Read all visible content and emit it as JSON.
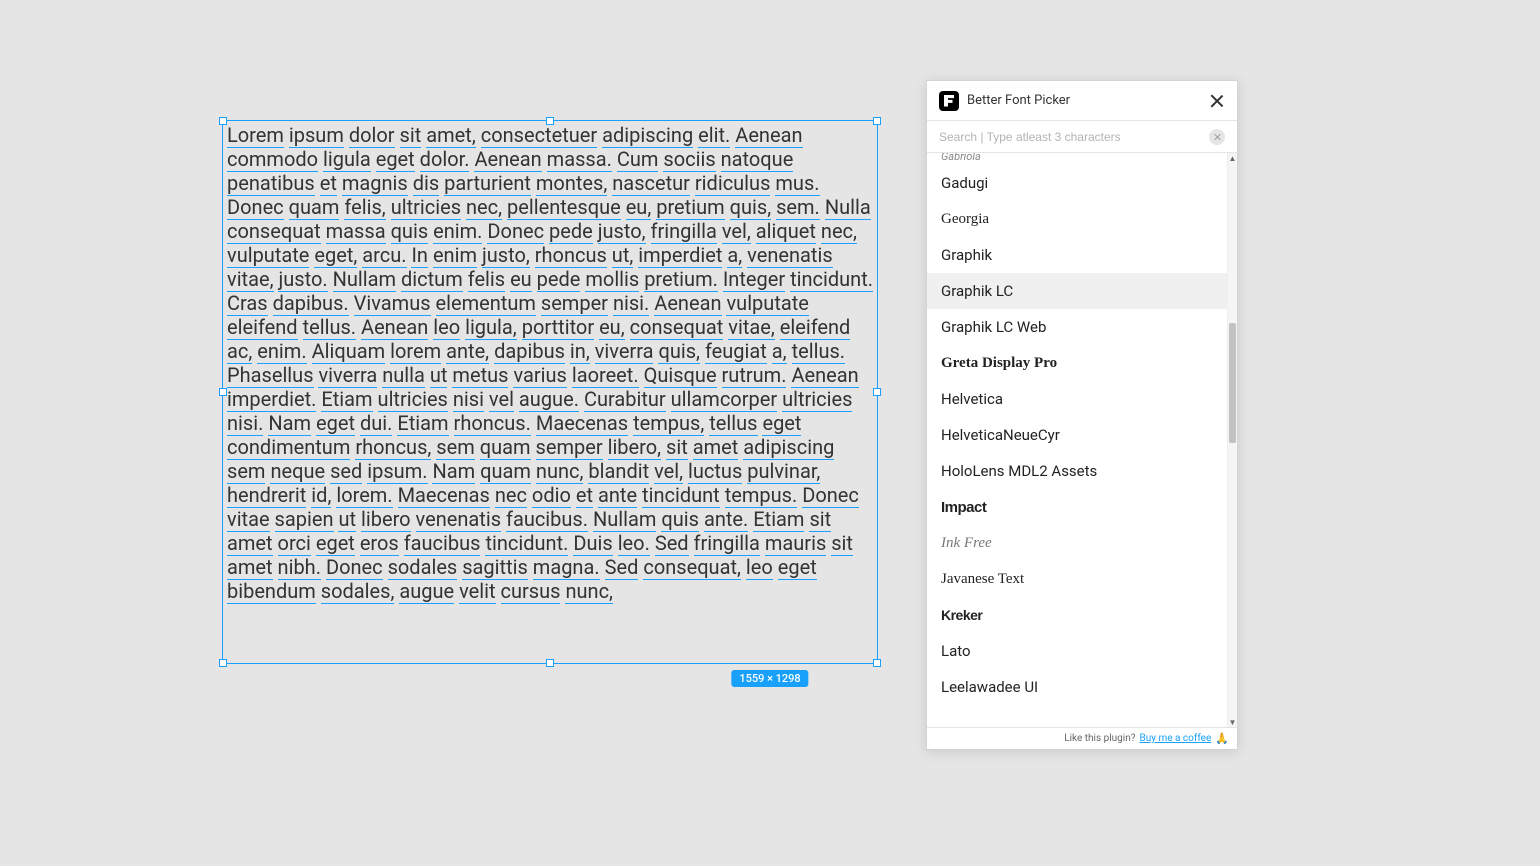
{
  "canvas": {
    "text": "Lorem ipsum dolor sit amet, consectetuer adipiscing elit. Aenean commodo ligula eget dolor. Aenean massa. Cum sociis natoque penatibus et magnis dis parturient montes, nascetur ridiculus mus. Donec quam felis, ultricies nec, pellentesque eu, pretium quis, sem. Nulla consequat massa quis enim. Donec pede justo, fringilla vel, aliquet nec, vulputate eget, arcu. In enim justo, rhoncus ut, imperdiet a, venenatis vitae, justo. Nullam dictum felis eu pede mollis pretium. Integer tincidunt. Cras dapibus. Vivamus elementum semper nisi. Aenean vulputate eleifend tellus. Aenean leo ligula, porttitor eu, consequat vitae, eleifend ac, enim. Aliquam lorem ante, dapibus in, viverra quis, feugiat a, tellus. Phasellus viverra nulla ut metus varius laoreet. Quisque rutrum. Aenean imperdiet. Etiam ultricies nisi vel augue. Curabitur ullamcorper ultricies nisi. Nam eget dui. Etiam rhoncus. Maecenas tempus, tellus eget condimentum rhoncus, sem quam semper libero, sit amet adipiscing sem neque sed ipsum. Nam quam nunc, blandit vel, luctus pulvinar, hendrerit id, lorem. Maecenas nec odio et ante tincidunt tempus. Donec vitae sapien ut libero venenatis faucibus. Nullam quis ante. Etiam sit amet orci eget eros faucibus tincidunt. Duis leo. Sed fringilla mauris sit amet nibh. Donec sodales sagittis magna. Sed consequat, leo eget bibendum sodales, augue velit cursus nunc,",
    "size_label": "1559 × 1298"
  },
  "panel": {
    "title": "Better Font Picker",
    "search_placeholder": "Search | Type atleast 3 characters",
    "partial_top": "Gabriola",
    "fonts": [
      {
        "name": "Gadugi",
        "cls": ""
      },
      {
        "name": "Georgia",
        "cls": "georgia"
      },
      {
        "name": "Graphik",
        "cls": ""
      },
      {
        "name": "Graphik LC",
        "cls": "",
        "hover": true
      },
      {
        "name": "Graphik LC Web",
        "cls": ""
      },
      {
        "name": "Greta Display Pro",
        "cls": "bold-serif"
      },
      {
        "name": "Helvetica",
        "cls": ""
      },
      {
        "name": "HelveticaNeueCyr",
        "cls": ""
      },
      {
        "name": "HoloLens MDL2 Assets",
        "cls": ""
      },
      {
        "name": "Impact",
        "cls": "impact"
      },
      {
        "name": "Ink Free",
        "cls": "script"
      },
      {
        "name": "Javanese Text",
        "cls": "serif"
      },
      {
        "name": "Kreker",
        "cls": "kreker"
      },
      {
        "name": "Lato",
        "cls": ""
      },
      {
        "name": "Leelawadee UI",
        "cls": ""
      }
    ],
    "footer_text": "Like this plugin?",
    "footer_link": "Buy me a coffee",
    "footer_emoji": "🙏"
  }
}
